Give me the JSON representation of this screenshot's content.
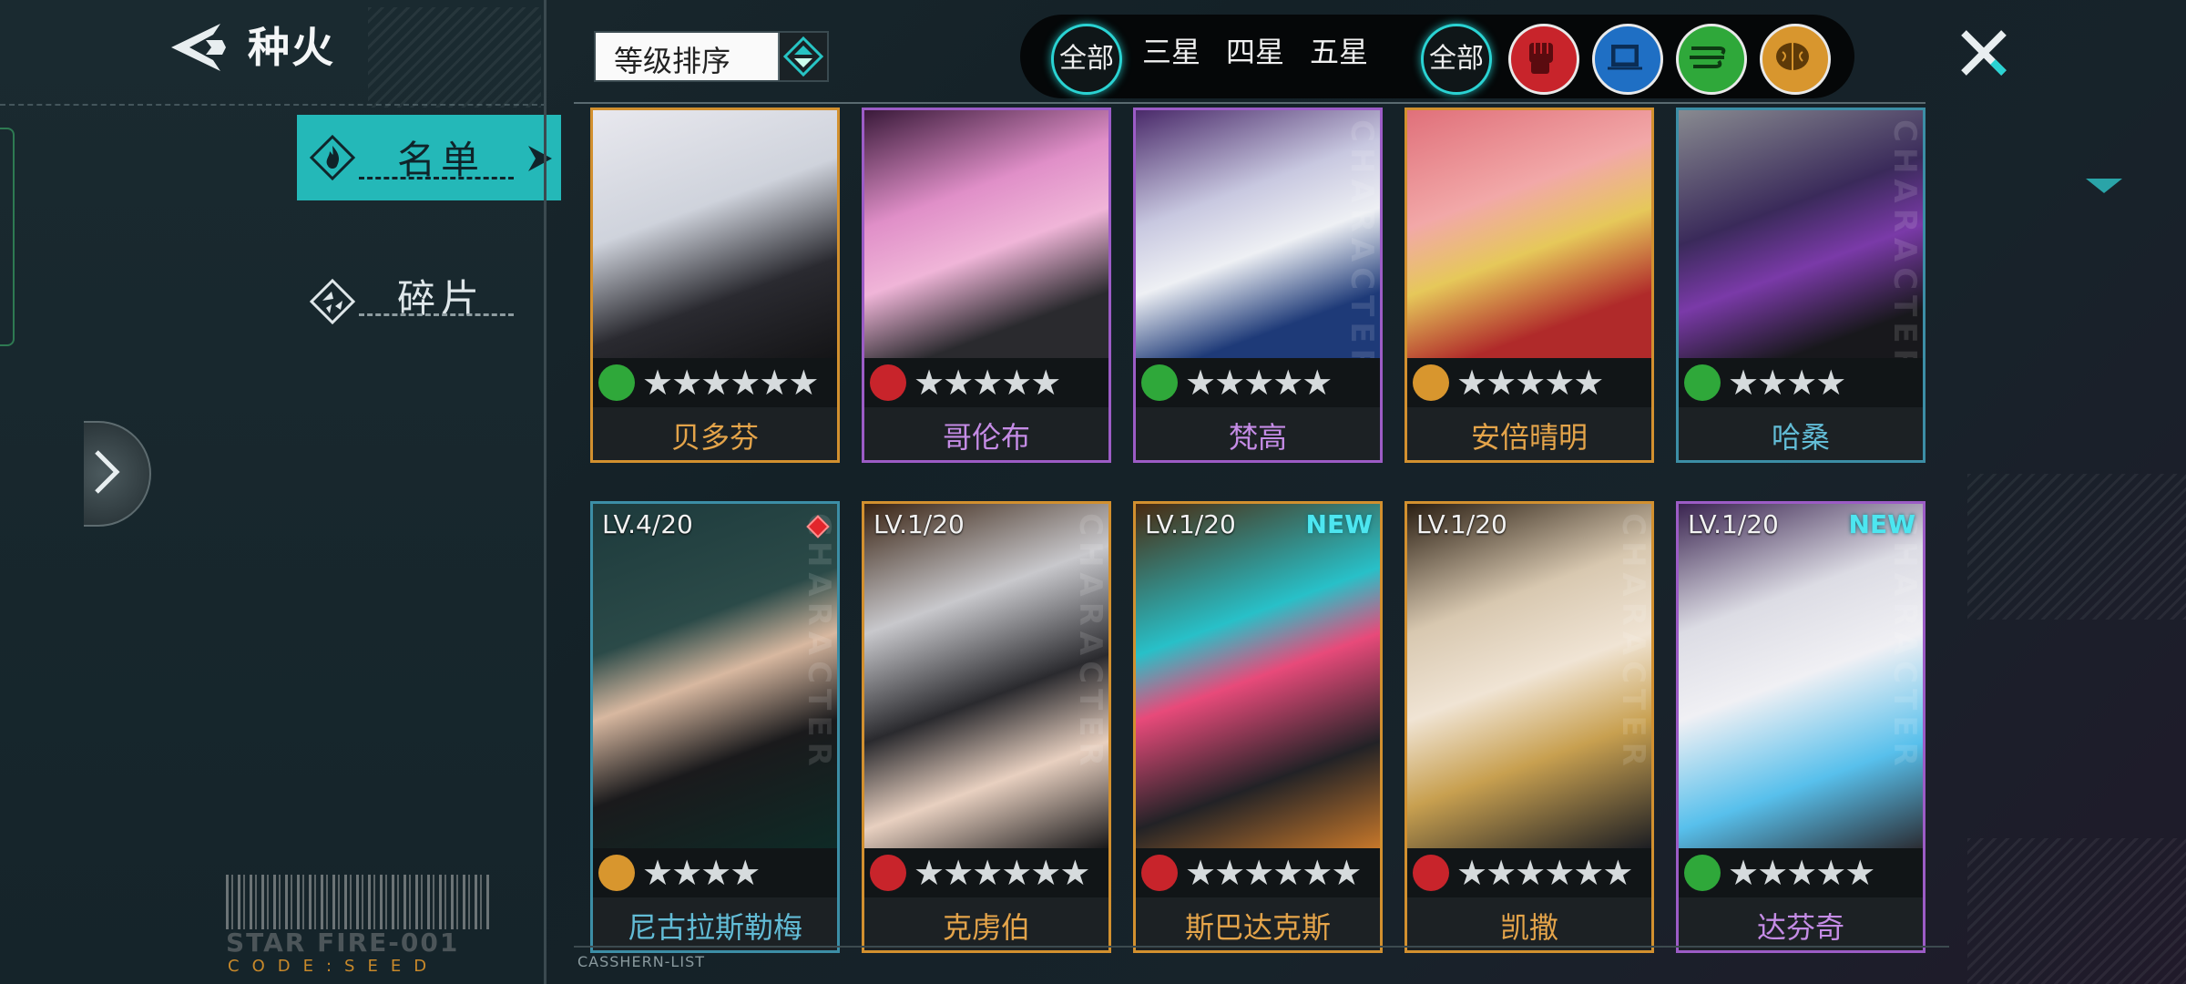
{
  "header": {
    "title": "种火"
  },
  "nav": {
    "tabs": [
      {
        "label": "名单",
        "active": true
      },
      {
        "label": "碎片",
        "active": false
      }
    ]
  },
  "sort": {
    "label": "等级排序"
  },
  "filters": {
    "rarity": [
      {
        "label": "全部",
        "active": true
      },
      {
        "label": "三星"
      },
      {
        "label": "四星"
      },
      {
        "label": "五星"
      }
    ],
    "type_all": "全部",
    "types": [
      {
        "icon": "fist-icon",
        "color": "#c8242b"
      },
      {
        "icon": "chip-icon",
        "color": "#1f6fc4"
      },
      {
        "icon": "wind-icon",
        "color": "#2fa83a"
      },
      {
        "icon": "brain-icon",
        "color": "#d8962e"
      }
    ]
  },
  "cards_row1": [
    {
      "name": "贝多芬",
      "rarity": "gold",
      "type": "wind-icon",
      "stars": "★★★★★★"
    },
    {
      "name": "哥伦布",
      "rarity": "purple",
      "type": "fist-icon",
      "stars": "★★★★★"
    },
    {
      "name": "梵高",
      "rarity": "purple",
      "type": "wind-icon",
      "stars": "★★★★★"
    },
    {
      "name": "安倍晴明",
      "rarity": "gold",
      "type": "brain-icon",
      "stars": "★★★★★"
    },
    {
      "name": "哈桑",
      "rarity": "blue",
      "type": "wind-icon",
      "stars": "★★★★"
    }
  ],
  "cards_row2": [
    {
      "name": "尼古拉斯勒梅",
      "level": "LV.4/20",
      "rarity": "blue",
      "type": "brain-icon",
      "stars": "★★★★",
      "alert": true
    },
    {
      "name": "克虏伯",
      "level": "LV.1/20",
      "rarity": "gold",
      "type": "fist-icon",
      "stars": "★★★★★★"
    },
    {
      "name": "斯巴达克斯",
      "level": "LV.1/20",
      "rarity": "gold",
      "type": "fist-icon",
      "stars": "★★★★★★",
      "new": "NEW"
    },
    {
      "name": "凯撒",
      "level": "LV.1/20",
      "rarity": "gold",
      "type": "fist-icon",
      "stars": "★★★★★★"
    },
    {
      "name": "达芬奇",
      "level": "LV.1/20",
      "rarity": "purple",
      "type": "wind-icon",
      "stars": "★★★★★",
      "new": "NEW"
    }
  ],
  "watermark": "CHARACTER",
  "footer": {
    "brand": "STAR FIRE-001",
    "code": "CODE:SEED",
    "list_label": "CASSHERN-LIST"
  }
}
